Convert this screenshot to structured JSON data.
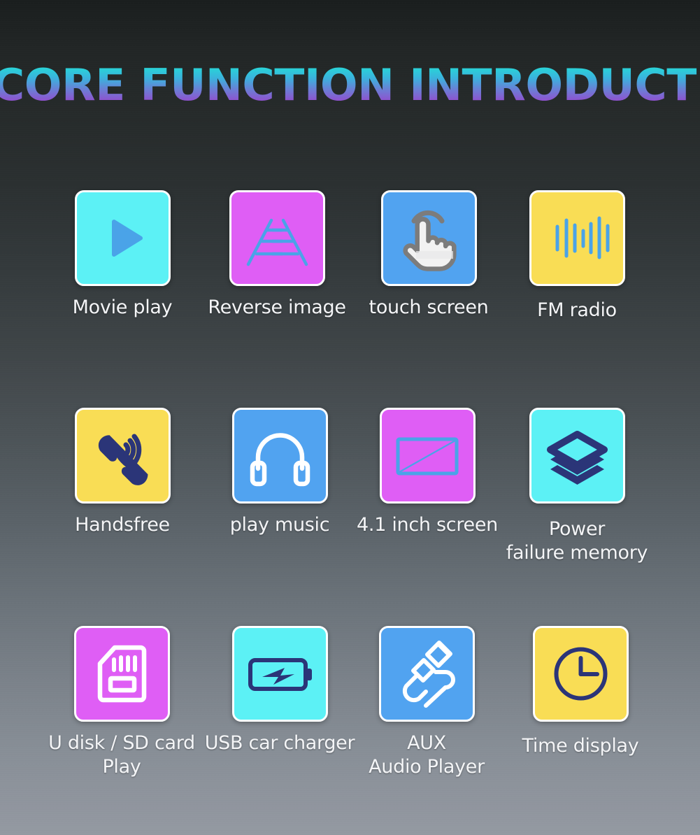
{
  "page": {
    "title": "CORE FUNCTION INTRODUCTION",
    "background_top_color": "#1a1e1e",
    "background_bottom_color": "#949aa2",
    "title_gradient_top": "#2ad9d0",
    "title_gradient_bottom": "#9747c9"
  },
  "colors": {
    "cyan": "#5cf1f5",
    "magenta": "#df5ef5",
    "blue": "#51a3f0",
    "yellow": "#f9dd55",
    "navy": "#2b3578",
    "white": "#ffffff",
    "icon_blue": "#4aa3e8"
  },
  "features": [
    {
      "id": "movie-play",
      "label": "Movie play",
      "icon": "play-triangle-icon",
      "tile_color": "#5cf1f5",
      "icon_color": "#4aa3e8",
      "row": 1,
      "col": 1
    },
    {
      "id": "reverse-image",
      "label": "Reverse image",
      "icon": "parking-guide-lines-icon",
      "tile_color": "#df5ef5",
      "icon_color": "#4aa3e8",
      "row": 1,
      "col": 2
    },
    {
      "id": "touch-screen",
      "label": "touch screen",
      "icon": "tap-hand-icon",
      "tile_color": "#51a3f0",
      "icon_color": "#ffffff",
      "row": 1,
      "col": 3
    },
    {
      "id": "fm-radio",
      "label": "FM radio",
      "icon": "audio-waveform-icon",
      "tile_color": "#f9dd55",
      "icon_color": "#4aa3e8",
      "row": 1,
      "col": 4
    },
    {
      "id": "handsfree",
      "label": "Handsfree",
      "icon": "phone-handset-icon",
      "tile_color": "#f9dd55",
      "icon_color": "#2b3578",
      "row": 2,
      "col": 1
    },
    {
      "id": "play-music",
      "label": "play music",
      "icon": "headphones-icon",
      "tile_color": "#51a3f0",
      "icon_color": "#ffffff",
      "row": 2,
      "col": 2
    },
    {
      "id": "screen-size",
      "label": "4.1 inch screen",
      "icon": "screen-diagonal-icon",
      "tile_color": "#df5ef5",
      "icon_color": "#4aa3e8",
      "row": 2,
      "col": 3
    },
    {
      "id": "power-failure-memory",
      "label": "Power\nfailure memory",
      "icon": "layers-stack-icon",
      "tile_color": "#5cf1f5",
      "icon_color": "#2b3578",
      "row": 2,
      "col": 4
    },
    {
      "id": "u-disk-sd-card",
      "label": "U disk / SD card\nPlay",
      "icon": "sd-card-icon",
      "tile_color": "#df5ef5",
      "icon_color": "#ffffff",
      "row": 3,
      "col": 1
    },
    {
      "id": "usb-car-charger",
      "label": "USB car charger",
      "icon": "battery-charging-icon",
      "tile_color": "#5cf1f5",
      "icon_color": "#2b3578",
      "row": 3,
      "col": 2
    },
    {
      "id": "aux-audio-player",
      "label": "AUX\nAudio Player",
      "icon": "aux-plug-cable-icon",
      "tile_color": "#51a3f0",
      "icon_color": "#ffffff",
      "row": 3,
      "col": 3
    },
    {
      "id": "time-display",
      "label": "Time display",
      "icon": "clock-icon",
      "tile_color": "#f9dd55",
      "icon_color": "#2b3578",
      "row": 3,
      "col": 4
    }
  ]
}
